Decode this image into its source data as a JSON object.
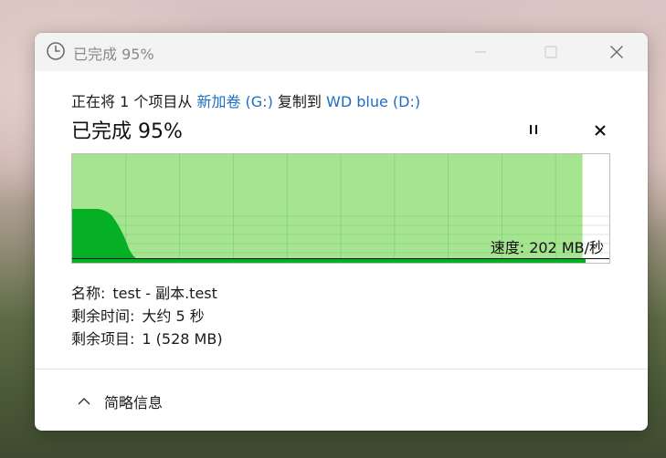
{
  "window": {
    "title": "已完成 95%"
  },
  "copy": {
    "prefix": "正在将 1 个项目从 ",
    "source": "新加卷 (G:)",
    "middle": " 复制到 ",
    "destination": "WD blue (D:)"
  },
  "progress": {
    "title": "已完成 95%",
    "percent": 95,
    "speed_label": "速度: 202 MB/秒"
  },
  "details": {
    "name_key": "名称:",
    "name_value": "test - 副本.test",
    "time_key": "剩余时间:",
    "time_value": "大约 5 秒",
    "items_key": "剩余项目:",
    "items_value": "1 (528 MB)"
  },
  "footer": {
    "more_label": "简略信息"
  },
  "colors": {
    "progress_fill": "#a6e590",
    "speed_fill": "#06b025",
    "link": "#1b6ec2"
  }
}
